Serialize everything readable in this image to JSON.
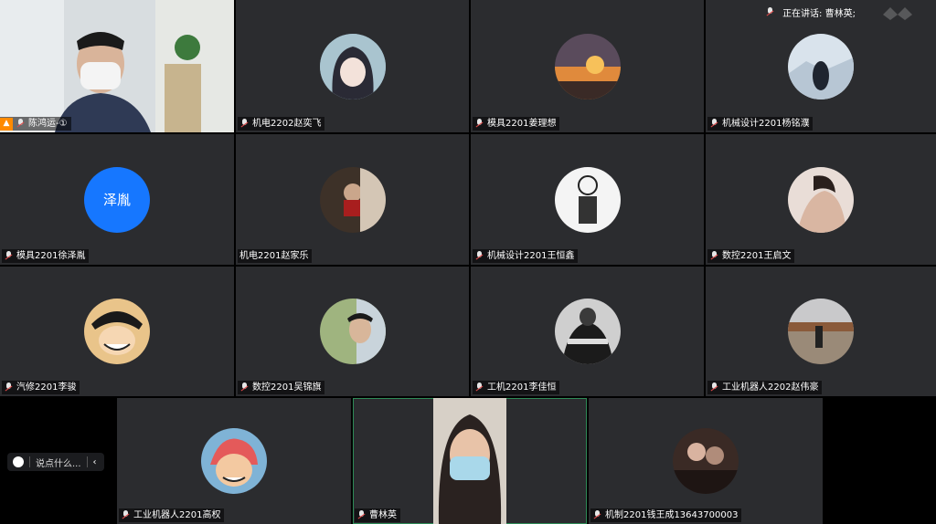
{
  "speaking": {
    "prefix": "正在讲话: ",
    "name": "曹林英;"
  },
  "chat": {
    "placeholder": "说点什么..."
  },
  "grid": [
    {
      "name": "陈鸿运-①",
      "type": "video_self"
    },
    {
      "name": "机电2202赵奕飞"
    },
    {
      "name": "模具2201姜理想"
    },
    {
      "name": "机械设计2201杨铭濮"
    },
    {
      "name": "模具2201徐泽胤",
      "avatar_text": "泽胤"
    },
    {
      "name": "机电2201赵家乐"
    },
    {
      "name": "机械设计2201王恒鑫"
    },
    {
      "name": "数控2201王启文"
    },
    {
      "name": "汽修2201李骏"
    },
    {
      "name": "数控2201吴锦旗"
    },
    {
      "name": "工机2201李佳恒"
    },
    {
      "name": "工业机器人2202赵伟豪"
    }
  ],
  "bottom": [
    {
      "name": "工业机器人2201高权"
    },
    {
      "name": "曹林英",
      "type": "video_active"
    },
    {
      "name": "机制2201钱王成13643700003"
    }
  ],
  "colors": {
    "tile": "#2b2c2f",
    "accent": "#1677ff",
    "host": "#ff8a00",
    "active_border": "#2e8b57"
  }
}
